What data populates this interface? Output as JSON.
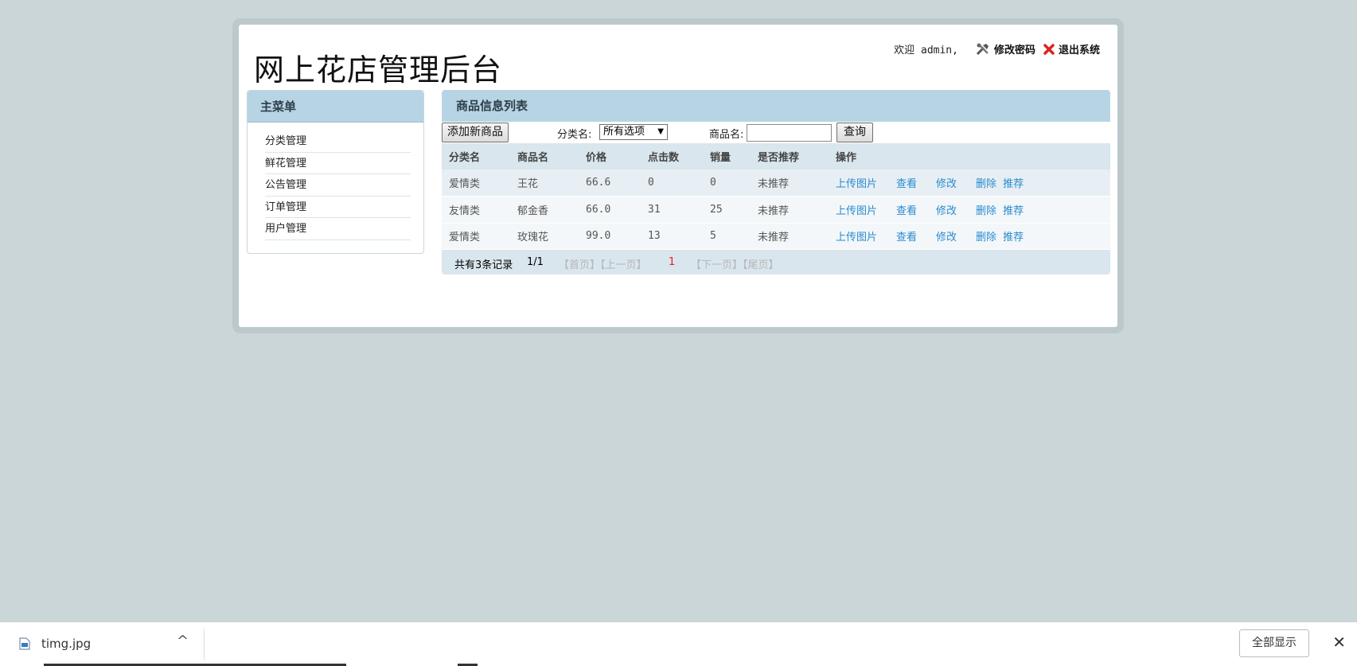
{
  "header": {
    "title": "网上花店管理后台",
    "welcome": "欢迎 admin,",
    "change_password": "修改密码",
    "logout": "退出系统"
  },
  "sidebar": {
    "title": "主菜单",
    "items": [
      {
        "label": "分类管理"
      },
      {
        "label": "鲜花管理"
      },
      {
        "label": "公告管理"
      },
      {
        "label": "订单管理"
      },
      {
        "label": "用户管理"
      }
    ]
  },
  "main": {
    "title": "商品信息列表",
    "add_button": "添加新商品",
    "category_label": "分类名:",
    "category_selected": "所有选项",
    "product_label": "商品名:",
    "product_value": "",
    "search_button": "查询",
    "columns": [
      "分类名",
      "商品名",
      "价格",
      "点击数",
      "销量",
      "是否推荐",
      "操作"
    ],
    "rows": [
      {
        "category": "爱情类",
        "name": "王花",
        "price": "66.6",
        "clicks": "0",
        "sales": "0",
        "recommend": "未推荐"
      },
      {
        "category": "友情类",
        "name": "郁金香",
        "price": "66.0",
        "clicks": "31",
        "sales": "25",
        "recommend": "未推荐"
      },
      {
        "category": "爱情类",
        "name": "玫瑰花",
        "price": "99.0",
        "clicks": "13",
        "sales": "5",
        "recommend": "未推荐"
      }
    ],
    "actions": {
      "upload": "上传图片",
      "view": "查看",
      "edit": "修改",
      "delete": "删除",
      "recommend": "推荐"
    },
    "pager": {
      "total": "共有3条记录",
      "page": "1/1",
      "first_prev": "【首页】【上一页】",
      "current": "1",
      "next_last": "【下一页】【尾页】"
    }
  },
  "download_bar": {
    "file_name": "timg.jpg",
    "show_all": "全部显示",
    "close": "✕",
    "caret": "^"
  },
  "colors": {
    "background": "#cbd6d9",
    "panel_header": "#b7d4e4",
    "link": "#2a8bd0",
    "current_page": "#e02020"
  }
}
